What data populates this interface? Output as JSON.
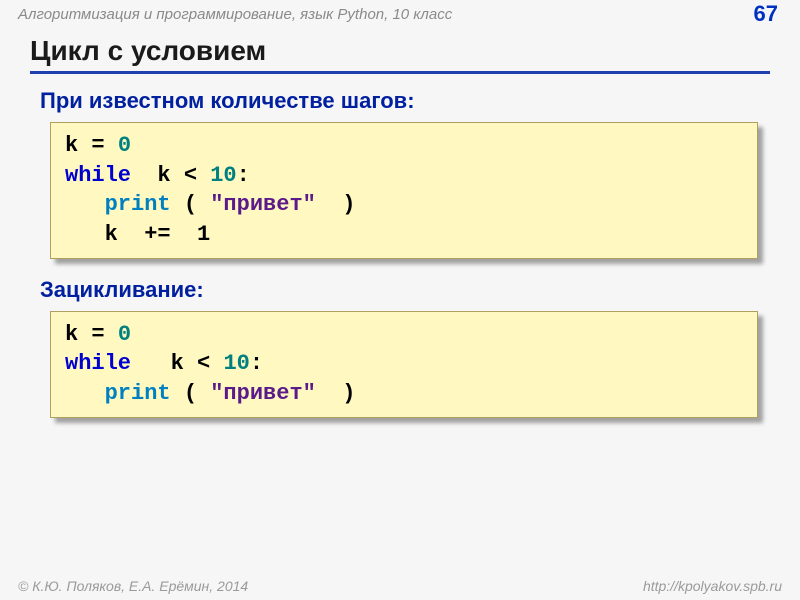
{
  "header": {
    "course": "Алгоритмизация и программирование, язык Python, 10 класс",
    "page": "67"
  },
  "title": "Цикл с условием",
  "sections": [
    {
      "heading": "При известном количестве шагов:",
      "code": {
        "l1a": "k = ",
        "l1b": "0",
        "l2a": "while",
        "l2b": "  k < ",
        "l2c": "10",
        "l2d": ":",
        "l3a": "   ",
        "l3b": "print",
        "l3c": " ( ",
        "l3d": "\"привет\"",
        "l3e": "  )",
        "l4": "   k  +=  1"
      }
    },
    {
      "heading": "Зацикливание:",
      "code": {
        "l1a": "k = ",
        "l1b": "0",
        "l2a": "while",
        "l2b": "   k < ",
        "l2c": "10",
        "l2d": ":",
        "l3a": "   ",
        "l3b": "print",
        "l3c": " ( ",
        "l3d": "\"привет\"",
        "l3e": "  )"
      }
    }
  ],
  "footer": {
    "authors": "© К.Ю. Поляков, Е.А. Ерёмин, 2014",
    "url": "http://kpolyakov.spb.ru"
  }
}
